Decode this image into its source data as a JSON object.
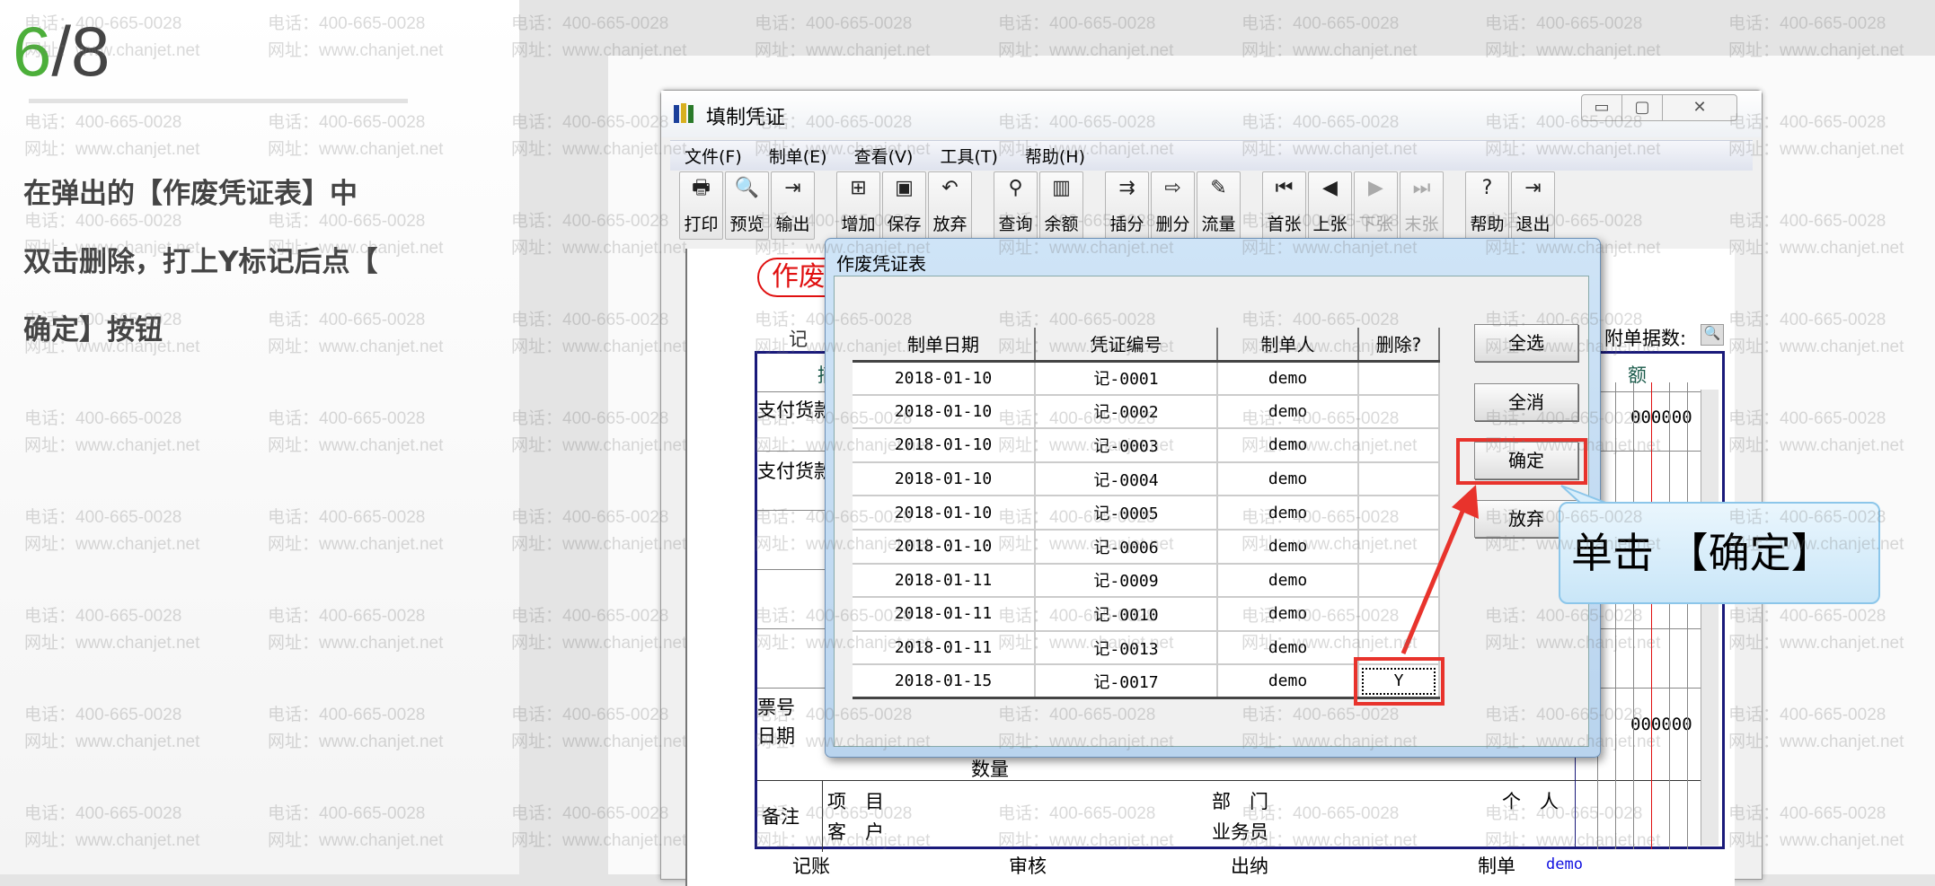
{
  "step": {
    "current": "6",
    "total": "/8"
  },
  "instruction": [
    "在弹出的【作废凭证表】中",
    "双击删除，打上Y标记后点【",
    "确定】按钮"
  ],
  "window": {
    "title": "填制凭证",
    "controls": [
      "▭",
      "▢",
      "✕"
    ]
  },
  "menu": [
    "文件(F)",
    "制单(E)",
    "查看(V)",
    "工具(T)",
    "帮助(H)"
  ],
  "toolbar": [
    {
      "label": "打印",
      "icon": "printer-icon",
      "glyph": "🖶",
      "enabled": true,
      "group": 1
    },
    {
      "label": "预览",
      "icon": "preview-icon",
      "glyph": "🔍",
      "enabled": true,
      "group": 1
    },
    {
      "label": "输出",
      "icon": "export-icon",
      "glyph": "⇥",
      "enabled": true,
      "group": 1
    },
    {
      "label": "增加",
      "icon": "add-icon",
      "glyph": "⊞",
      "enabled": true,
      "group": 2
    },
    {
      "label": "保存",
      "icon": "save-icon",
      "glyph": "▣",
      "enabled": true,
      "group": 2
    },
    {
      "label": "放弃",
      "icon": "undo-icon",
      "glyph": "↶",
      "enabled": true,
      "group": 2
    },
    {
      "label": "查询",
      "icon": "binoculars-icon",
      "glyph": "⚲",
      "enabled": true,
      "group": 3
    },
    {
      "label": "余额",
      "icon": "bar-chart-icon",
      "glyph": "▥",
      "enabled": true,
      "group": 3
    },
    {
      "label": "插分",
      "icon": "insert-row-icon",
      "glyph": "⇉",
      "enabled": true,
      "group": 4
    },
    {
      "label": "删分",
      "icon": "delete-row-icon",
      "glyph": "⇨",
      "enabled": true,
      "group": 4
    },
    {
      "label": "流量",
      "icon": "edit-icon",
      "glyph": "✎",
      "enabled": true,
      "group": 4
    },
    {
      "label": "首张",
      "icon": "first-icon",
      "glyph": "⏮",
      "enabled": true,
      "group": 5
    },
    {
      "label": "上张",
      "icon": "prev-icon",
      "glyph": "◀",
      "enabled": true,
      "group": 5
    },
    {
      "label": "下张",
      "icon": "next-icon",
      "glyph": "▶",
      "enabled": false,
      "group": 5
    },
    {
      "label": "末张",
      "icon": "last-icon",
      "glyph": "⏭",
      "enabled": false,
      "group": 5
    },
    {
      "label": "帮助",
      "icon": "help-icon",
      "glyph": "?",
      "enabled": true,
      "group": 6
    },
    {
      "label": "退出",
      "icon": "exit-icon",
      "glyph": "⇥",
      "enabled": true,
      "group": 6
    }
  ],
  "voucher": {
    "stamp": "作废",
    "type_char": "记",
    "attachments_label": "附单据数:",
    "summary_header": "摘",
    "amount_header": "额",
    "rows": [
      "支付货款",
      "支付货款"
    ],
    "amount_values": [
      "000000",
      "000000"
    ],
    "ticket_no": "票号",
    "date": "日期",
    "quantity": "数量",
    "remark": "备注",
    "project": "项　目",
    "customer": "客　户",
    "department": "部　门",
    "salesperson": "业务员",
    "individual": "个　人",
    "bookkeeper": "记账",
    "auditor": "审核",
    "cashier": "出纳",
    "maker_label": "制单",
    "maker": "demo"
  },
  "dialog": {
    "title": "作废凭证表",
    "columns": [
      "制单日期",
      "凭证编号",
      "制单人",
      "删除?"
    ],
    "rows": [
      [
        "2018-01-10",
        "记-0001",
        "demo",
        ""
      ],
      [
        "2018-01-10",
        "记-0002",
        "demo",
        ""
      ],
      [
        "2018-01-10",
        "记-0003",
        "demo",
        ""
      ],
      [
        "2018-01-10",
        "记-0004",
        "demo",
        ""
      ],
      [
        "2018-01-10",
        "记-0005",
        "demo",
        ""
      ],
      [
        "2018-01-10",
        "记-0006",
        "demo",
        ""
      ],
      [
        "2018-01-11",
        "记-0009",
        "demo",
        ""
      ],
      [
        "2018-01-11",
        "记-0010",
        "demo",
        ""
      ],
      [
        "2018-01-11",
        "记-0013",
        "demo",
        ""
      ],
      [
        "2018-01-15",
        "记-0017",
        "demo",
        "Y"
      ]
    ],
    "buttons": {
      "select_all": "全选",
      "deselect_all": "全消",
      "ok": "确定",
      "cancel": "放弃"
    }
  },
  "callout": "单击 【确定】",
  "watermark": {
    "phone": "电话：400-665-0028",
    "site": "网址：www.chanjet.net"
  },
  "colors": {
    "accent_green": "#4caf3a",
    "highlight_red": "#e8332c",
    "voucher_border": "#1a1a7a"
  }
}
